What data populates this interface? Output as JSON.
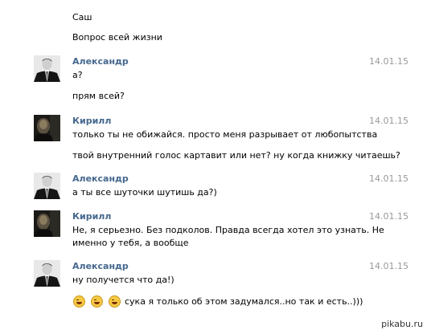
{
  "messages": [
    {
      "text": "Саш"
    },
    {
      "text": "Вопрос всей жизни"
    },
    {
      "author": "Александр",
      "date": "14.01.15",
      "avatar": "avatar-suit",
      "lines": [
        "а?",
        "прям всей?"
      ]
    },
    {
      "author": "Кирилл",
      "date": "14.01.15",
      "avatar": "avatar-dark-portrait",
      "lines": [
        "только ты не обижайся. просто меня разрывает от любопытства",
        "твой внутренний голос картавит или нет? ну когда книжку читаешь?"
      ]
    },
    {
      "author": "Александр",
      "date": "14.01.15",
      "avatar": "avatar-suit",
      "lines": [
        "а ты все шуточки шутишь да?)"
      ]
    },
    {
      "author": "Кирилл",
      "date": "14.01.15",
      "avatar": "avatar-dark-portrait",
      "lines": [
        "Не, я серьезно. Без подколов. Правда всегда хотел это узнать. Не",
        "именно у тебя, а вообще"
      ]
    },
    {
      "author": "Александр",
      "date": "14.01.15",
      "avatar": "avatar-suit",
      "lines": [
        "ну получется что да!)",
        "сука я только об этом задумался..но так и есть..)))"
      ],
      "emoji": [
        "laughing-emoji",
        "laughing-emoji",
        "laughing-emoji"
      ]
    }
  ],
  "watermark": "pikabu.ru",
  "colors": {
    "author": "#45688e",
    "date": "#999999",
    "text": "#000000"
  }
}
